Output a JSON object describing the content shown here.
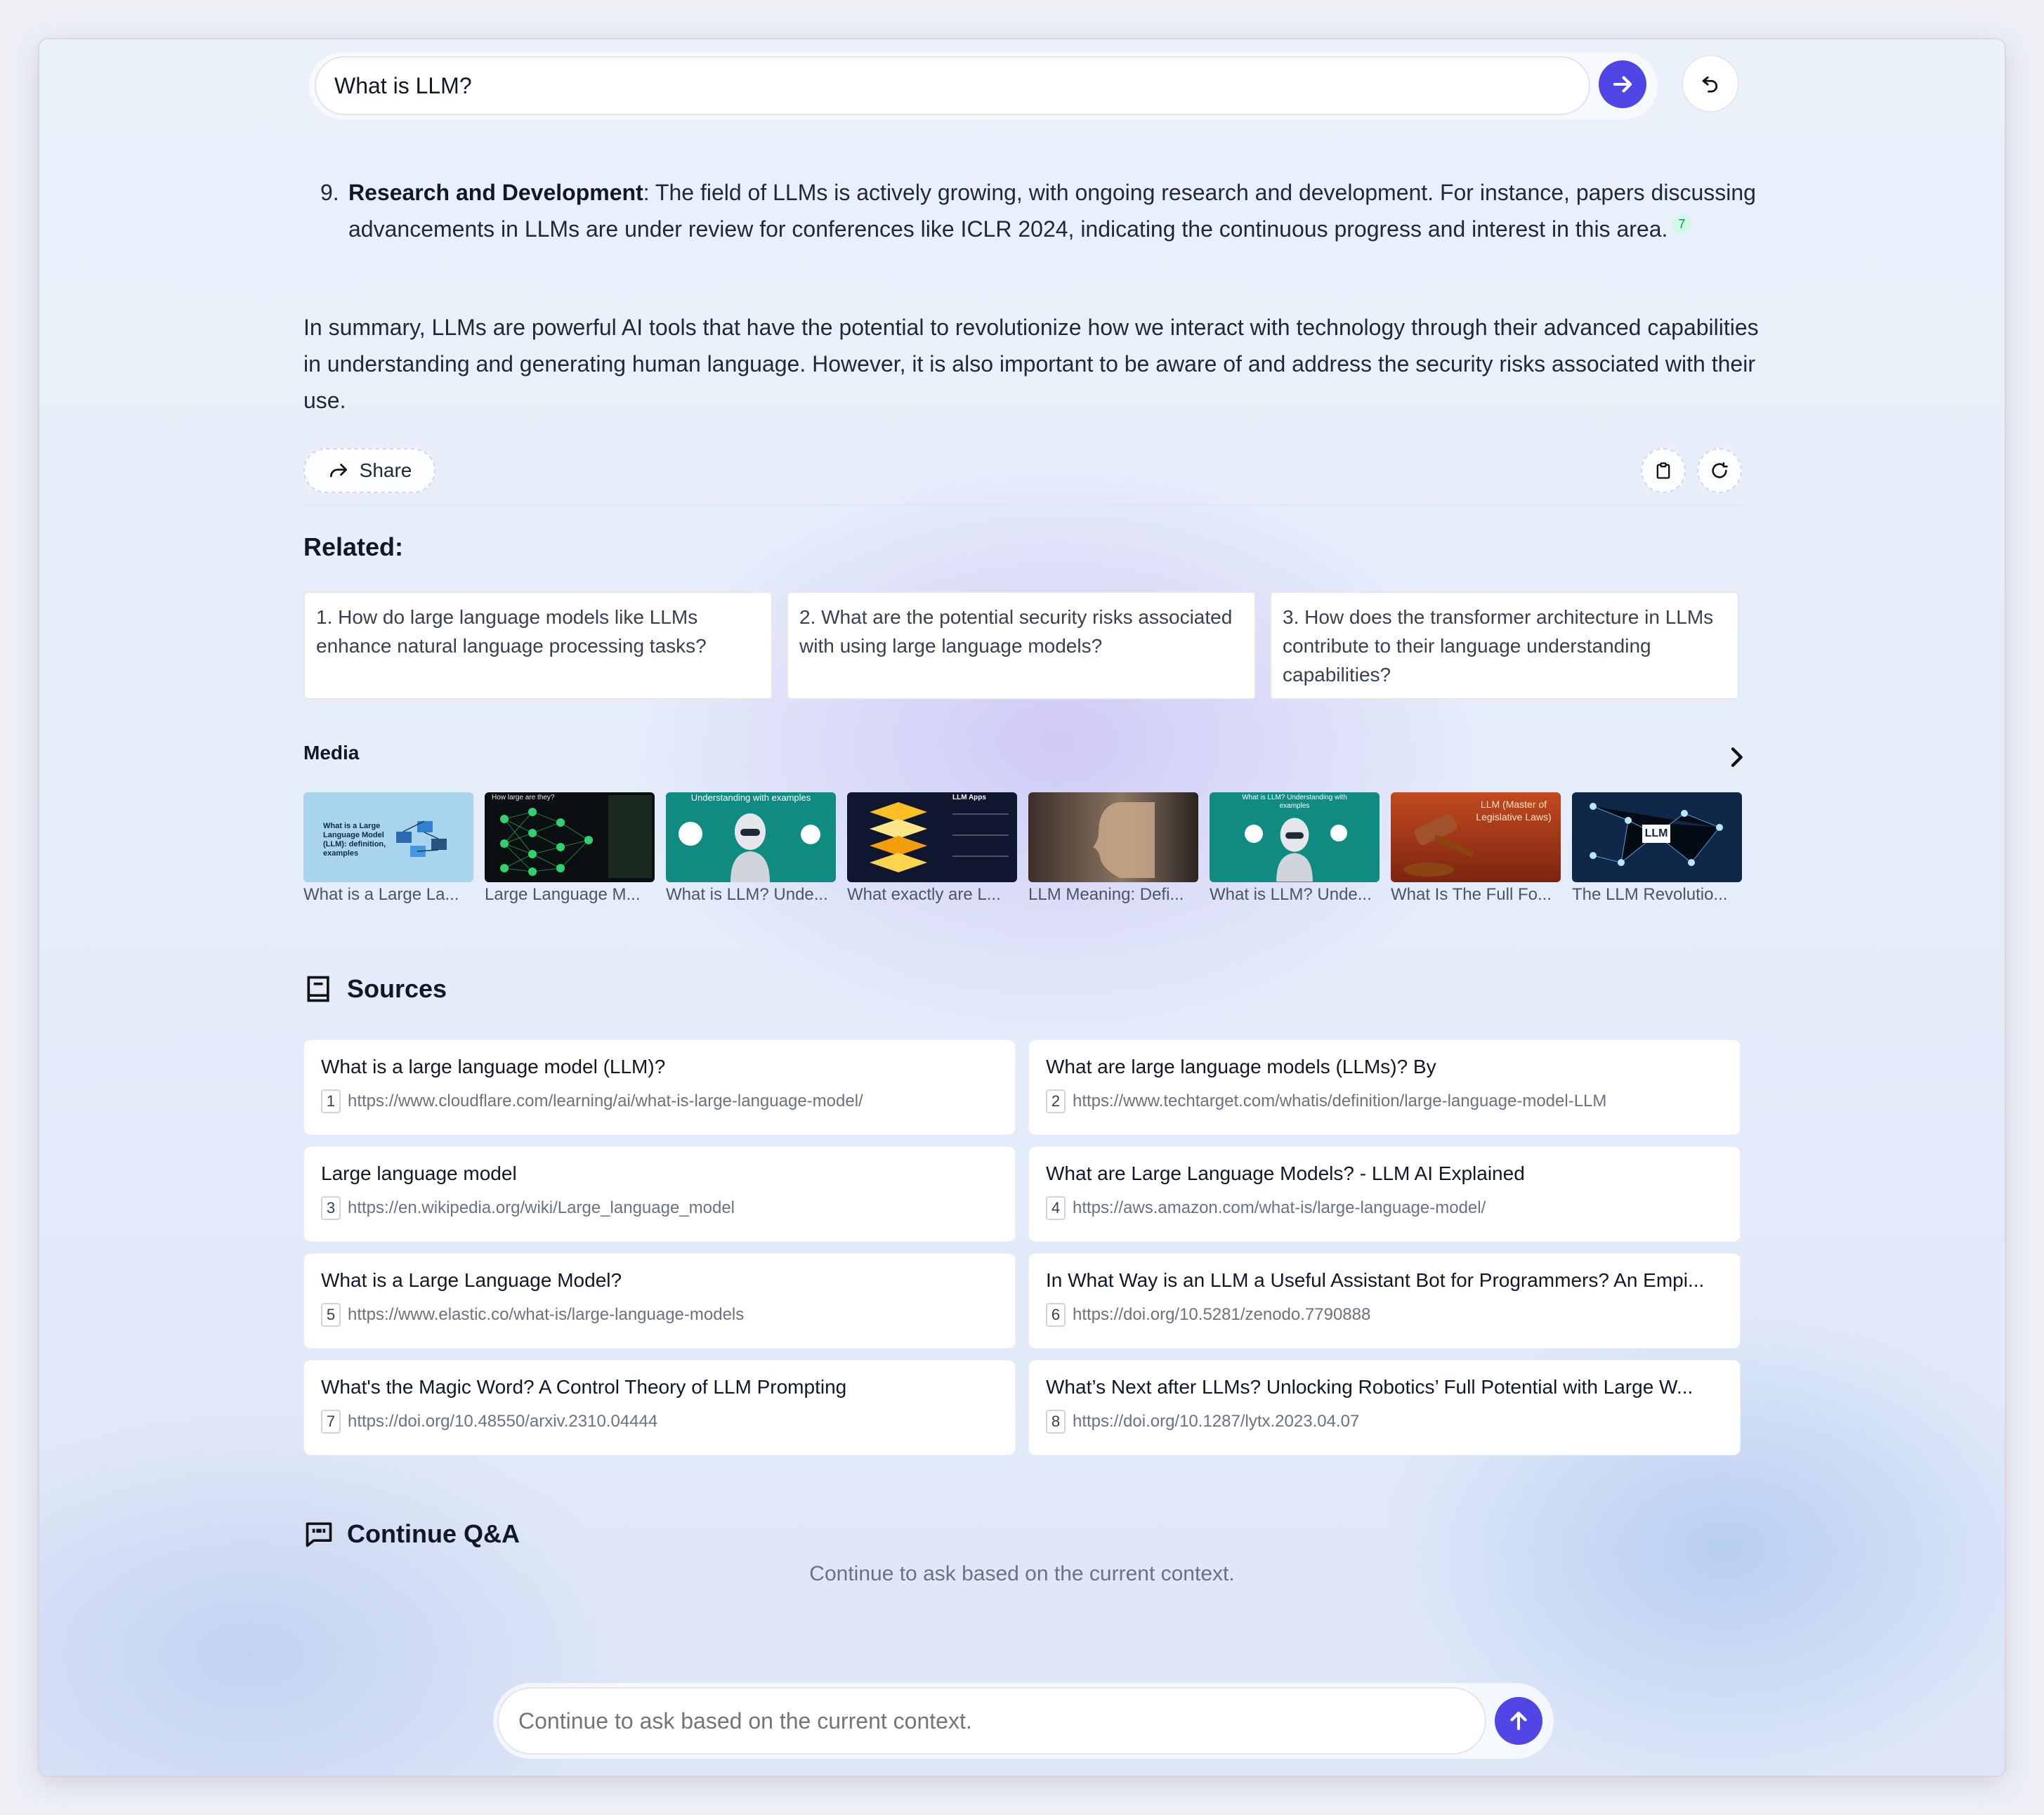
{
  "search": {
    "query": "What is LLM?"
  },
  "answer": {
    "item_number": "9.",
    "item_bold": "Research and Development",
    "item_text": ": The field of LLMs is actively growing, with ongoing research and development. For instance, papers discussing advancements in LLMs are under review for conferences like ICLR 2024, indicating the continuous progress and interest in this area.",
    "item_citation": "7",
    "summary": "In summary, LLMs are powerful AI tools that have the potential to revolutionize how we interact with technology through their advanced capabilities in understanding and generating human language. However, it is also important to be aware of and address the security risks associated with their use."
  },
  "actions": {
    "share_label": "Share"
  },
  "related": {
    "title": "Related:",
    "items": [
      "1. How do large language models like LLMs enhance natural language processing tasks?",
      "2. What are the potential security risks associated with using large language models?",
      "3. How does the transformer architecture in LLMs contribute to their language understanding capabilities?"
    ]
  },
  "media": {
    "title": "Media",
    "items": [
      {
        "caption": "What is a Large La...",
        "thumb_text": "What is a Large Language Model (LLM): definition, examples",
        "color": "#a9d4ee"
      },
      {
        "caption": "Large Language M...",
        "thumb_text": "How large are they?",
        "color": "#0b0f12"
      },
      {
        "caption": "What is LLM? Unde...",
        "thumb_text": "Understanding with examples",
        "color": "#0f8b82"
      },
      {
        "caption": "What exactly are L...",
        "thumb_text": "LLM Apps",
        "color": "#0e1630"
      },
      {
        "caption": "LLM Meaning: Defi...",
        "thumb_text": "",
        "color": "#5b4a3c"
      },
      {
        "caption": "What is LLM? Unde...",
        "thumb_text": "What is LLM? Understanding with examples",
        "color": "#0f8b82"
      },
      {
        "caption": "What Is The Full Fo...",
        "thumb_text": "LLM (Master of Legislative Laws)",
        "color": "#b33a18"
      },
      {
        "caption": "The LLM Revolutio...",
        "thumb_text": "LLM",
        "color": "#0f2748"
      }
    ]
  },
  "sources": {
    "title": "Sources",
    "items": [
      {
        "num": "1",
        "title": "What is a large language model (LLM)?",
        "url": "https://www.cloudflare.com/learning/ai/what-is-large-language-model/"
      },
      {
        "num": "2",
        "title": "What are large language models (LLMs)? By",
        "url": "https://www.techtarget.com/whatis/definition/large-language-model-LLM"
      },
      {
        "num": "3",
        "title": "Large language model",
        "url": "https://en.wikipedia.org/wiki/Large_language_model"
      },
      {
        "num": "4",
        "title": "What are Large Language Models? - LLM AI Explained",
        "url": "https://aws.amazon.com/what-is/large-language-model/"
      },
      {
        "num": "5",
        "title": "What is a Large Language Model?",
        "url": "https://www.elastic.co/what-is/large-language-models"
      },
      {
        "num": "6",
        "title": "In What Way is an LLM a Useful Assistant Bot for Programmers? An Empi...",
        "url": "https://doi.org/10.5281/zenodo.7790888"
      },
      {
        "num": "7",
        "title": "What's the Magic Word? A Control Theory of LLM Prompting",
        "url": "https://doi.org/10.48550/arxiv.2310.04444"
      },
      {
        "num": "8",
        "title": "What’s Next after LLMs? Unlocking Robotics’ Full Potential with Large W...",
        "url": "https://doi.org/10.1287/lytx.2023.04.07"
      }
    ]
  },
  "continue": {
    "title": "Continue Q&A",
    "hint": "Continue to ask based on the current context.",
    "placeholder": "Continue to ask based on the current context."
  },
  "colors": {
    "accent": "#4f46e5"
  }
}
